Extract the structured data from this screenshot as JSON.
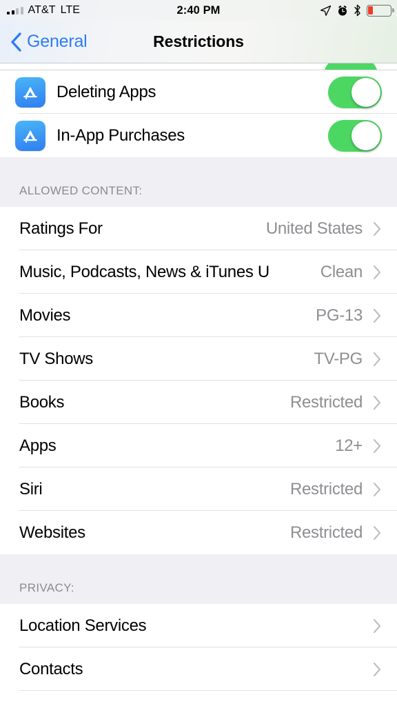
{
  "status_bar": {
    "carrier": "AT&T",
    "network": "LTE",
    "time": "2:40 PM",
    "icons": [
      "location-arrow-icon",
      "alarm-clock-icon",
      "bluetooth-icon",
      "battery-icon"
    ],
    "battery_level_percent": 18,
    "battery_color": "#ef3b2d",
    "signal_bars_filled": 2,
    "signal_bars_total": 4
  },
  "nav_bar": {
    "back_label": "General",
    "title": "Restrictions",
    "tint_color": "#2f7cf6"
  },
  "allow_section": {
    "rows": [
      {
        "label": "Deleting Apps",
        "icon": "app-store-icon",
        "toggle": "on"
      },
      {
        "label": "In-App Purchases",
        "icon": "app-store-icon",
        "toggle": "on"
      }
    ]
  },
  "allowed_content": {
    "header": "ALLOWED CONTENT:",
    "rows": [
      {
        "label": "Ratings For",
        "value": "United States"
      },
      {
        "label": "Music, Podcasts, News & iTunes U",
        "value": "Clean"
      },
      {
        "label": "Movies",
        "value": "PG-13"
      },
      {
        "label": "TV Shows",
        "value": "TV-PG"
      },
      {
        "label": "Books",
        "value": "Restricted"
      },
      {
        "label": "Apps",
        "value": "12+"
      },
      {
        "label": "Siri",
        "value": "Restricted"
      },
      {
        "label": "Websites",
        "value": "Restricted"
      }
    ]
  },
  "privacy": {
    "header": "PRIVACY:",
    "rows": [
      {
        "label": "Location Services",
        "value": ""
      },
      {
        "label": "Contacts",
        "value": ""
      }
    ]
  },
  "colors": {
    "toggle_on": "#4cd763",
    "value_text": "#8e8e93",
    "section_background": "#efeff4",
    "separator": "#e0e0e2"
  }
}
